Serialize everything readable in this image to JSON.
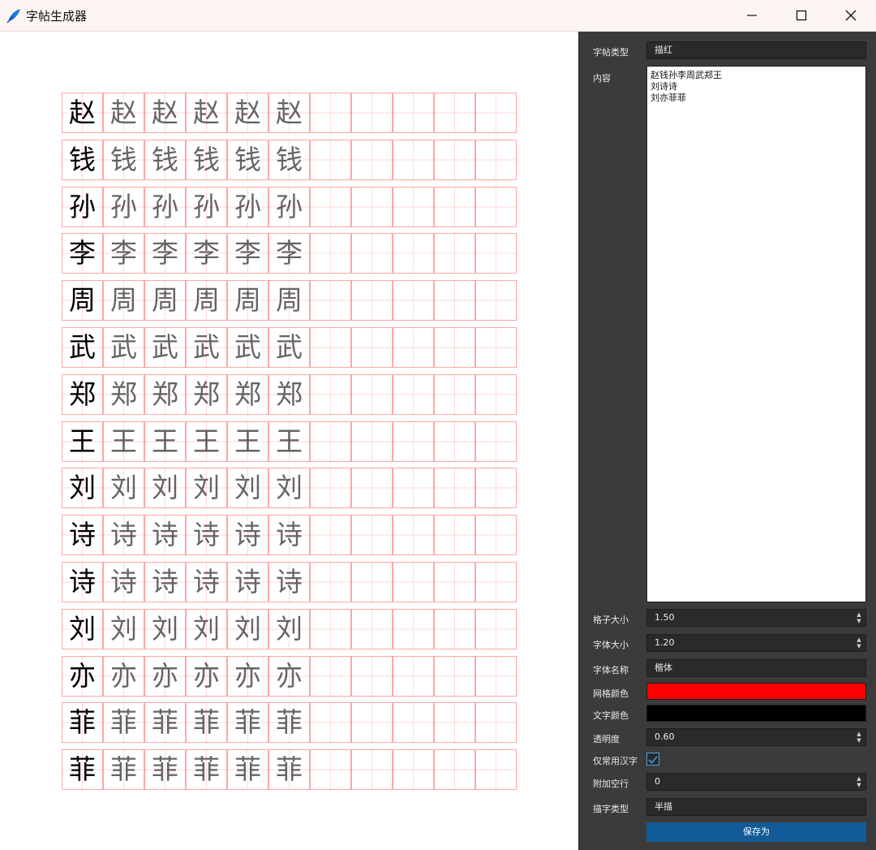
{
  "window": {
    "title": "字帖生成器"
  },
  "rows": [
    {
      "char": "赵"
    },
    {
      "char": "钱"
    },
    {
      "char": "孙"
    },
    {
      "char": "李"
    },
    {
      "char": "周"
    },
    {
      "char": "武"
    },
    {
      "char": "郑"
    },
    {
      "char": "王"
    },
    {
      "char": "刘"
    },
    {
      "char": "诗"
    },
    {
      "char": "诗"
    },
    {
      "char": "刘"
    },
    {
      "char": "亦"
    },
    {
      "char": "菲"
    },
    {
      "char": "菲"
    }
  ],
  "colors": {
    "grid": "#ff0000",
    "text": "#000000",
    "accent": "#115b98"
  },
  "panel": {
    "type_label": "字帖类型",
    "type_value": "描红",
    "content_label": "内容",
    "content_value": "赵钱孙李周武郑王\n刘诗诗\n刘亦菲菲",
    "cell_size_label": "格子大小",
    "cell_size_value": "1.50",
    "font_size_label": "字体大小",
    "font_size_value": "1.20",
    "font_name_label": "字体名称",
    "font_name_value": "楷体",
    "grid_color_label": "网格颜色",
    "text_color_label": "文字颜色",
    "opacity_label": "透明度",
    "opacity_value": "0.60",
    "common_only_label": "仅常用汉字",
    "common_only_checked": true,
    "extra_rows_label": "附加空行",
    "extra_rows_value": "0",
    "trace_type_label": "描字类型",
    "trace_type_value": "半描",
    "save_label": "保存为"
  }
}
